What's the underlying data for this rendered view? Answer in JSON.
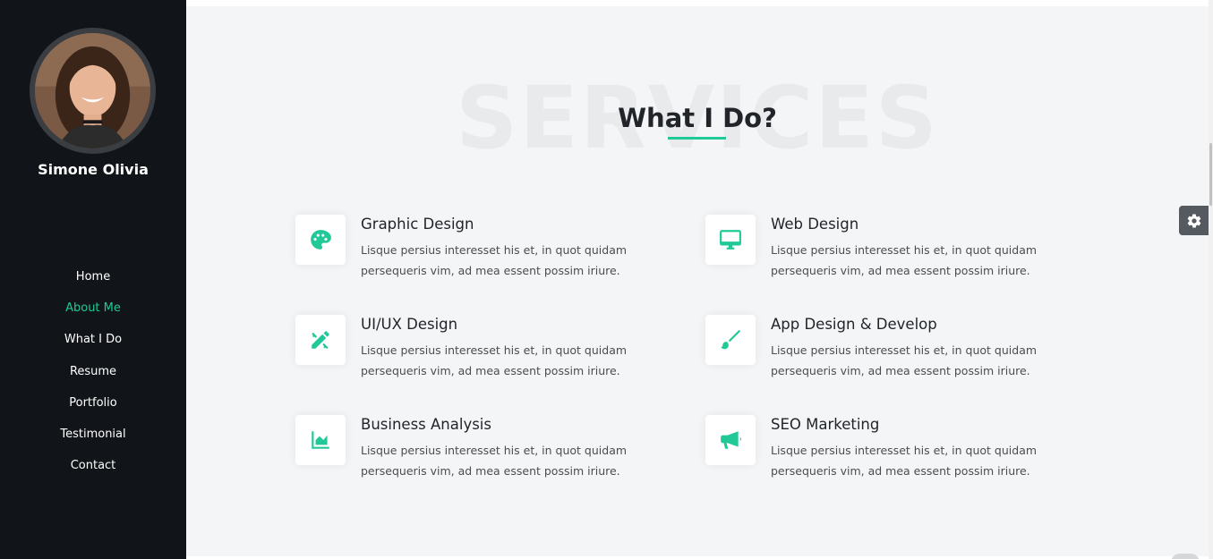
{
  "sidebar": {
    "name": "Simone Olivia",
    "nav": [
      {
        "label": "Home",
        "active": false
      },
      {
        "label": "About Me",
        "active": true
      },
      {
        "label": "What I Do",
        "active": false
      },
      {
        "label": "Resume",
        "active": false
      },
      {
        "label": "Portfolio",
        "active": false
      },
      {
        "label": "Testimonial",
        "active": false
      },
      {
        "label": "Contact",
        "active": false
      }
    ]
  },
  "section": {
    "bg_title": "SERVICES",
    "title": "What I Do?"
  },
  "services": [
    {
      "icon": "palette-icon",
      "title": "Graphic Design",
      "desc": "Lisque persius interesset his et, in quot quidam persequeris vim, ad mea essent possim iriure."
    },
    {
      "icon": "desktop-icon",
      "title": "Web Design",
      "desc": "Lisque persius interesset his et, in quot quidam persequeris vim, ad mea essent possim iriure."
    },
    {
      "icon": "pencil-ruler-icon",
      "title": "UI/UX Design",
      "desc": "Lisque persius interesset his et, in quot quidam persequeris vim, ad mea essent possim iriure."
    },
    {
      "icon": "paint-brush-icon",
      "title": "App Design & Develop",
      "desc": "Lisque persius interesset his et, in quot quidam persequeris vim, ad mea essent possim iriure."
    },
    {
      "icon": "chart-area-icon",
      "title": "Business Analysis",
      "desc": "Lisque persius interesset his et, in quot quidam persequeris vim, ad mea essent possim iriure."
    },
    {
      "icon": "bullhorn-icon",
      "title": "SEO Marketing",
      "desc": "Lisque persius interesset his et, in quot quidam persequeris vim, ad mea essent possim iriure."
    }
  ],
  "colors": {
    "accent": "#20c997",
    "sidebar_bg": "#111418",
    "page_bg": "#f4f5f7"
  }
}
